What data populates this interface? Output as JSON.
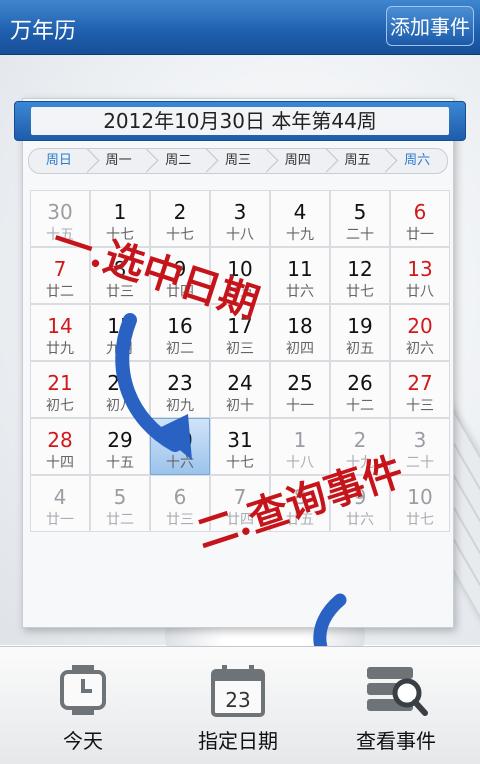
{
  "app": {
    "title": "万年历",
    "add_event_label": "添加事件"
  },
  "calendar": {
    "header": "2012年10月30日   本年第44周",
    "weekdays": [
      "周日",
      "周一",
      "周二",
      "周三",
      "周四",
      "周五",
      "周六"
    ],
    "days": [
      {
        "num": "30",
        "lunar": "十五",
        "other": true
      },
      {
        "num": "1",
        "lunar": "十七"
      },
      {
        "num": "2",
        "lunar": "十七"
      },
      {
        "num": "3",
        "lunar": "十八"
      },
      {
        "num": "4",
        "lunar": "十九"
      },
      {
        "num": "5",
        "lunar": "二十"
      },
      {
        "num": "6",
        "lunar": "廿一",
        "red": true
      },
      {
        "num": "7",
        "lunar": "廿二",
        "red": true
      },
      {
        "num": "8",
        "lunar": "廿三"
      },
      {
        "num": "9",
        "lunar": "廿四"
      },
      {
        "num": "10",
        "lunar": "廿五"
      },
      {
        "num": "11",
        "lunar": "廿六"
      },
      {
        "num": "12",
        "lunar": "廿七"
      },
      {
        "num": "13",
        "lunar": "廿八",
        "red": true
      },
      {
        "num": "14",
        "lunar": "廿九",
        "red": true
      },
      {
        "num": "15",
        "lunar": "九月"
      },
      {
        "num": "16",
        "lunar": "初二"
      },
      {
        "num": "17",
        "lunar": "初三"
      },
      {
        "num": "18",
        "lunar": "初四"
      },
      {
        "num": "19",
        "lunar": "初五"
      },
      {
        "num": "20",
        "lunar": "初六",
        "red": true
      },
      {
        "num": "21",
        "lunar": "初七",
        "red": true
      },
      {
        "num": "22",
        "lunar": "初八"
      },
      {
        "num": "23",
        "lunar": "初九"
      },
      {
        "num": "24",
        "lunar": "初十"
      },
      {
        "num": "25",
        "lunar": "十一"
      },
      {
        "num": "26",
        "lunar": "十二"
      },
      {
        "num": "27",
        "lunar": "十三",
        "red": true
      },
      {
        "num": "28",
        "lunar": "十四",
        "red": true
      },
      {
        "num": "29",
        "lunar": "十五"
      },
      {
        "num": "30",
        "lunar": "十六",
        "selected": true
      },
      {
        "num": "31",
        "lunar": "十七"
      },
      {
        "num": "1",
        "lunar": "十八",
        "other": true
      },
      {
        "num": "2",
        "lunar": "十九",
        "other": true
      },
      {
        "num": "3",
        "lunar": "二十",
        "other": true
      },
      {
        "num": "4",
        "lunar": "廿一",
        "other": true
      },
      {
        "num": "5",
        "lunar": "廿二",
        "other": true
      },
      {
        "num": "6",
        "lunar": "廿三",
        "other": true
      },
      {
        "num": "7",
        "lunar": "廿四",
        "other": true
      },
      {
        "num": "8",
        "lunar": "廿五",
        "other": true
      },
      {
        "num": "9",
        "lunar": "廿六",
        "other": true
      },
      {
        "num": "10",
        "lunar": "廿七",
        "other": true
      }
    ]
  },
  "annotations": {
    "step1": "一.选中日期",
    "step2": "二.查询事件"
  },
  "toolbar": {
    "today_label": "今天",
    "date_label": "指定日期",
    "date_icon_num": "23",
    "events_label": "查看事件"
  },
  "colors": {
    "accent": "#1f5fae",
    "weekend": "#d1191a",
    "annotation": "#c5151b",
    "arrow": "#2a62c4"
  },
  "icons": {
    "today": "clock-icon",
    "date": "calendar-icon",
    "events": "server-search-icon"
  }
}
